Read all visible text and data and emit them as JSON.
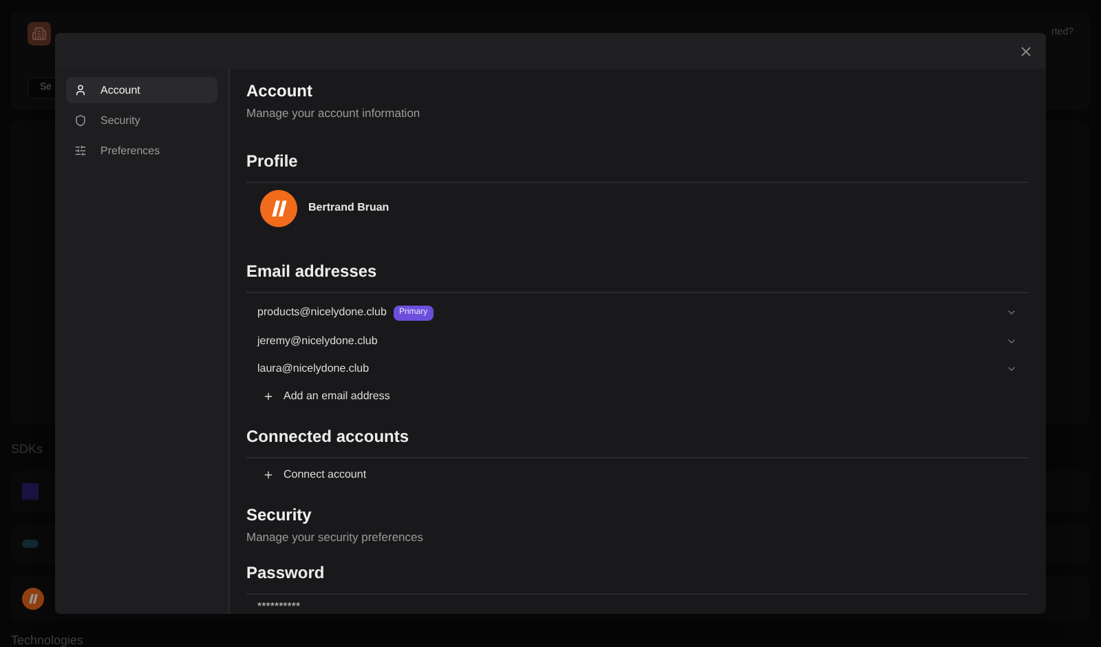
{
  "background": {
    "search": {
      "placeholder": "Se"
    },
    "corner_text": "rted?",
    "sdks_heading": "SDKs",
    "technologies_heading": "Technologies"
  },
  "dialog": {
    "sidebar": {
      "items": [
        {
          "label": "Account",
          "selected": true
        },
        {
          "label": "Security",
          "selected": false
        },
        {
          "label": "Preferences",
          "selected": false
        }
      ]
    },
    "account": {
      "title": "Account",
      "subtitle": "Manage your account information",
      "profile": {
        "heading": "Profile",
        "name": "Bertrand Bruan"
      },
      "emails": {
        "heading": "Email addresses",
        "items": [
          {
            "address": "products@nicelydone.club",
            "badge": "Primary"
          },
          {
            "address": "jeremy@nicelydone.club"
          },
          {
            "address": "laura@nicelydone.club"
          }
        ],
        "add_label": "Add an email address"
      },
      "connected": {
        "heading": "Connected accounts",
        "add_label": "Connect account"
      }
    },
    "security": {
      "title": "Security",
      "subtitle": "Manage your security preferences",
      "password": {
        "heading": "Password",
        "value": "**********"
      }
    }
  }
}
